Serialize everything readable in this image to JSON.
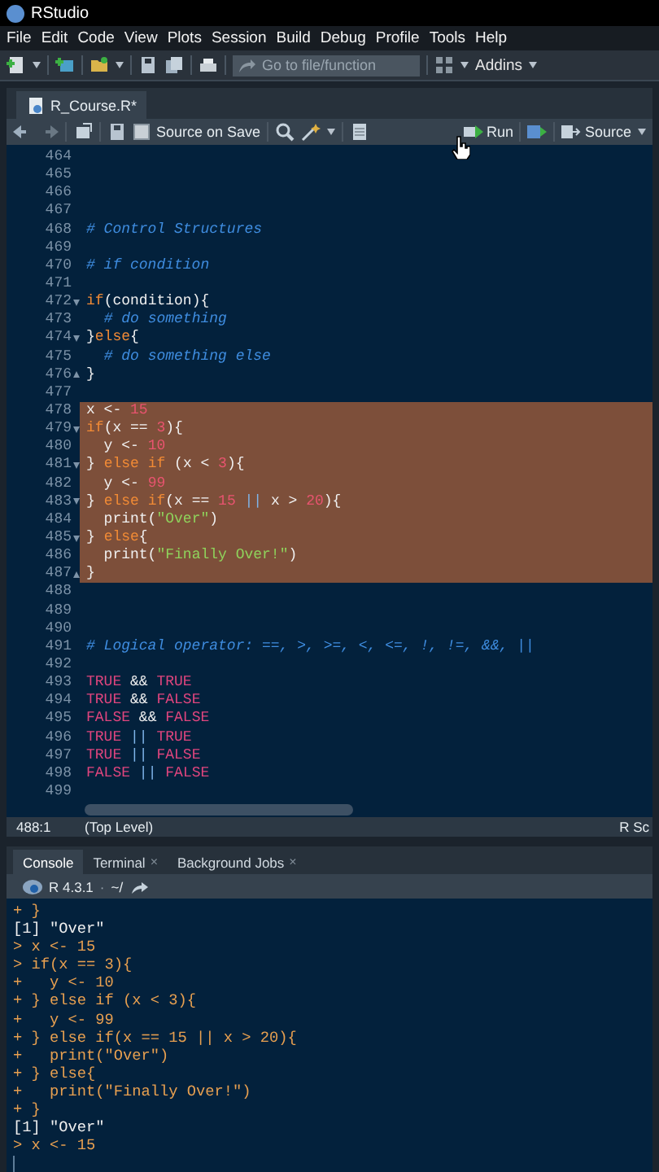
{
  "window": {
    "title": "RStudio"
  },
  "menu": [
    "File",
    "Edit",
    "Code",
    "View",
    "Plots",
    "Session",
    "Build",
    "Debug",
    "Profile",
    "Tools",
    "Help"
  ],
  "toolbar": {
    "search": {
      "placeholder": "Go to file/function"
    },
    "addins": "Addins"
  },
  "editor": {
    "tabs": [
      {
        "label": "R_Course.R*",
        "selected": true
      }
    ],
    "toolbar": {
      "source_on_save": {
        "label": "Source on Save",
        "checked": false
      },
      "run": "Run",
      "source": "Source"
    },
    "lines": [
      {
        "n": "464",
        "kind": "code",
        "selected": false
      },
      {
        "n": "465",
        "kind": "code",
        "selected": false
      },
      {
        "n": "466",
        "kind": "code",
        "selected": false
      },
      {
        "n": "467",
        "kind": "code",
        "selected": false
      },
      {
        "n": "468",
        "kind": "code",
        "selected": false,
        "text": "# Control Structures"
      },
      {
        "n": "469",
        "kind": "code",
        "selected": false
      },
      {
        "n": "470",
        "kind": "code",
        "selected": false,
        "text": "# if condition"
      },
      {
        "n": "471",
        "kind": "code",
        "selected": false
      },
      {
        "n": "472",
        "kind": "fold-start",
        "selected": false,
        "text": "if(condition){"
      },
      {
        "n": "473",
        "kind": "code",
        "selected": false,
        "text": "  # do something"
      },
      {
        "n": "474",
        "kind": "fold-start",
        "selected": false,
        "text": "}else{"
      },
      {
        "n": "475",
        "kind": "code",
        "selected": false,
        "text": "  # do something else"
      },
      {
        "n": "476",
        "kind": "fold-end",
        "selected": false,
        "text": "}"
      },
      {
        "n": "477",
        "kind": "code",
        "selected": false
      },
      {
        "n": "478",
        "kind": "code",
        "selected": true,
        "text": "x <- 15"
      },
      {
        "n": "479",
        "kind": "fold-start",
        "selected": true,
        "text": "if(x == 3){"
      },
      {
        "n": "480",
        "kind": "code",
        "selected": true,
        "text": "  y <- 10"
      },
      {
        "n": "481",
        "kind": "fold-start",
        "selected": true,
        "text": "} else if (x < 3){"
      },
      {
        "n": "482",
        "kind": "code",
        "selected": true,
        "text": "  y <- 99"
      },
      {
        "n": "483",
        "kind": "fold-start",
        "selected": true,
        "text": "} else if(x == 15 || x > 20){"
      },
      {
        "n": "484",
        "kind": "code",
        "selected": true,
        "text": "  print(\"Over\")"
      },
      {
        "n": "485",
        "kind": "fold-start",
        "selected": true,
        "text": "} else{"
      },
      {
        "n": "486",
        "kind": "code",
        "selected": true,
        "text": "  print(\"Finally Over!\")"
      },
      {
        "n": "487",
        "kind": "fold-end",
        "selected": true,
        "text": "}"
      },
      {
        "n": "488",
        "kind": "code",
        "selected": false
      },
      {
        "n": "489",
        "kind": "code",
        "selected": false
      },
      {
        "n": "490",
        "kind": "code",
        "selected": false
      },
      {
        "n": "491",
        "kind": "code",
        "selected": false,
        "text": "# Logical operator: ==, >, >=, <, <=, !, !=, &&, ||"
      },
      {
        "n": "492",
        "kind": "code",
        "selected": false
      },
      {
        "n": "493",
        "kind": "code",
        "selected": false,
        "text": "TRUE && TRUE"
      },
      {
        "n": "494",
        "kind": "code",
        "selected": false,
        "text": "TRUE && FALSE"
      },
      {
        "n": "495",
        "kind": "code",
        "selected": false,
        "text": "FALSE && FALSE"
      },
      {
        "n": "496",
        "kind": "code",
        "selected": false,
        "text": "TRUE || TRUE"
      },
      {
        "n": "497",
        "kind": "code",
        "selected": false,
        "text": "TRUE || FALSE"
      },
      {
        "n": "498",
        "kind": "code",
        "selected": false,
        "text": "FALSE || FALSE"
      },
      {
        "n": "499",
        "kind": "code",
        "selected": false
      }
    ],
    "status_bar": {
      "position": "488:1",
      "scope": "(Top Level)",
      "file_type": "R Sc"
    }
  },
  "console": {
    "tabs": [
      {
        "label": "Console",
        "selected": true
      },
      {
        "label": "Terminal",
        "selected": false,
        "close": "×"
      },
      {
        "label": "Background Jobs",
        "selected": false,
        "close": "×"
      }
    ],
    "version": "R 4.3.1",
    "separator": "·",
    "path": "~/",
    "lines": [
      {
        "kind": "input",
        "text": "+ }"
      },
      {
        "kind": "output",
        "text": "[1] \"Over\""
      },
      {
        "kind": "input",
        "text": "> x <- 15"
      },
      {
        "kind": "input",
        "text": "> if(x == 3){"
      },
      {
        "kind": "input",
        "text": "+   y <- 10"
      },
      {
        "kind": "input",
        "text": "+ } else if (x < 3){"
      },
      {
        "kind": "input",
        "text": "+   y <- 99"
      },
      {
        "kind": "input",
        "text": "+ } else if(x == 15 || x > 20){"
      },
      {
        "kind": "input",
        "text": "+   print(\"Over\")"
      },
      {
        "kind": "input",
        "text": "+ } else{"
      },
      {
        "kind": "input",
        "text": "+   print(\"Finally Over!\")"
      },
      {
        "kind": "input",
        "text": "+ }"
      },
      {
        "kind": "output",
        "text": "[1] \"Over\""
      },
      {
        "kind": "input",
        "text": "> x <- 15"
      }
    ]
  }
}
